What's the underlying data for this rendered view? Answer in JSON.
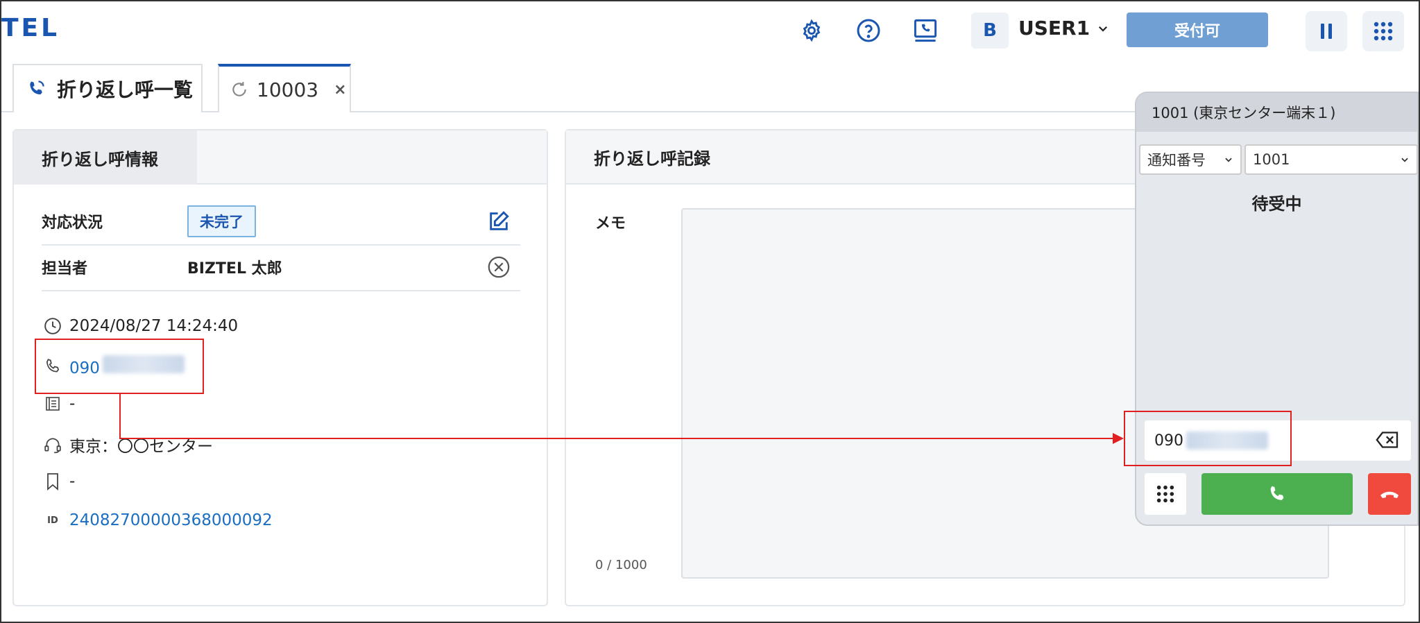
{
  "header": {
    "logo": "TEL",
    "avatar_letter": "B",
    "username": "USER1",
    "status_button": "受付可"
  },
  "tabs": [
    {
      "label": "折り返し呼一覧"
    },
    {
      "label": "10003",
      "close": "×"
    }
  ],
  "info_panel": {
    "title": "折り返し呼情報",
    "status_label": "対応状況",
    "status_value": "未完了",
    "assignee_label": "担当者",
    "assignee_value": "BIZTEL 太郎",
    "datetime": "2024/08/27 14:24:40",
    "phone_prefix": "090",
    "note": "-",
    "center": "東京：〇〇センター",
    "bookmark": "-",
    "id_icon_text": "ID",
    "id": "24082700000368000092"
  },
  "record_panel": {
    "title": "折り返し呼記録",
    "memo_label": "メモ",
    "counter": "0 / 1000"
  },
  "phone": {
    "title": "1001 (東京センター端末１)",
    "notify_select": "通知番号",
    "number_select": "1001",
    "state": "待受中",
    "dial_prefix": "090"
  },
  "colors": {
    "brand": "#1a56b0",
    "status_button": "#6f9fd3",
    "call": "#4cb050",
    "hangup": "#f04a3e",
    "annotation": "#e02020"
  }
}
